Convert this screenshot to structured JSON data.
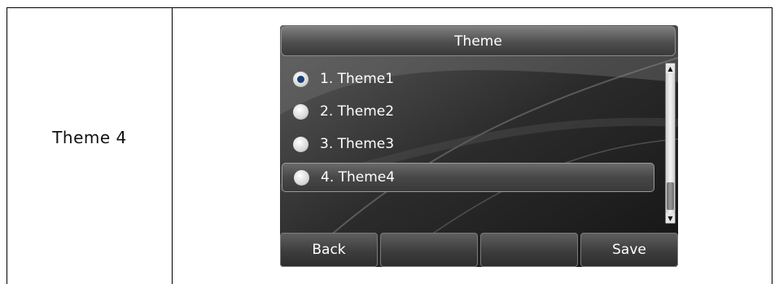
{
  "caption": "Theme 4",
  "screen": {
    "title": "Theme",
    "items": [
      {
        "label": "1. Theme1",
        "checked": true
      },
      {
        "label": "2. Theme2",
        "checked": false
      },
      {
        "label": "3. Theme3",
        "checked": false
      },
      {
        "label": "4. Theme4",
        "checked": false,
        "selected": true
      }
    ],
    "scroll": {
      "up": "▲",
      "down": "▼"
    },
    "softkeys": [
      "Back",
      "",
      "",
      "Save"
    ]
  }
}
